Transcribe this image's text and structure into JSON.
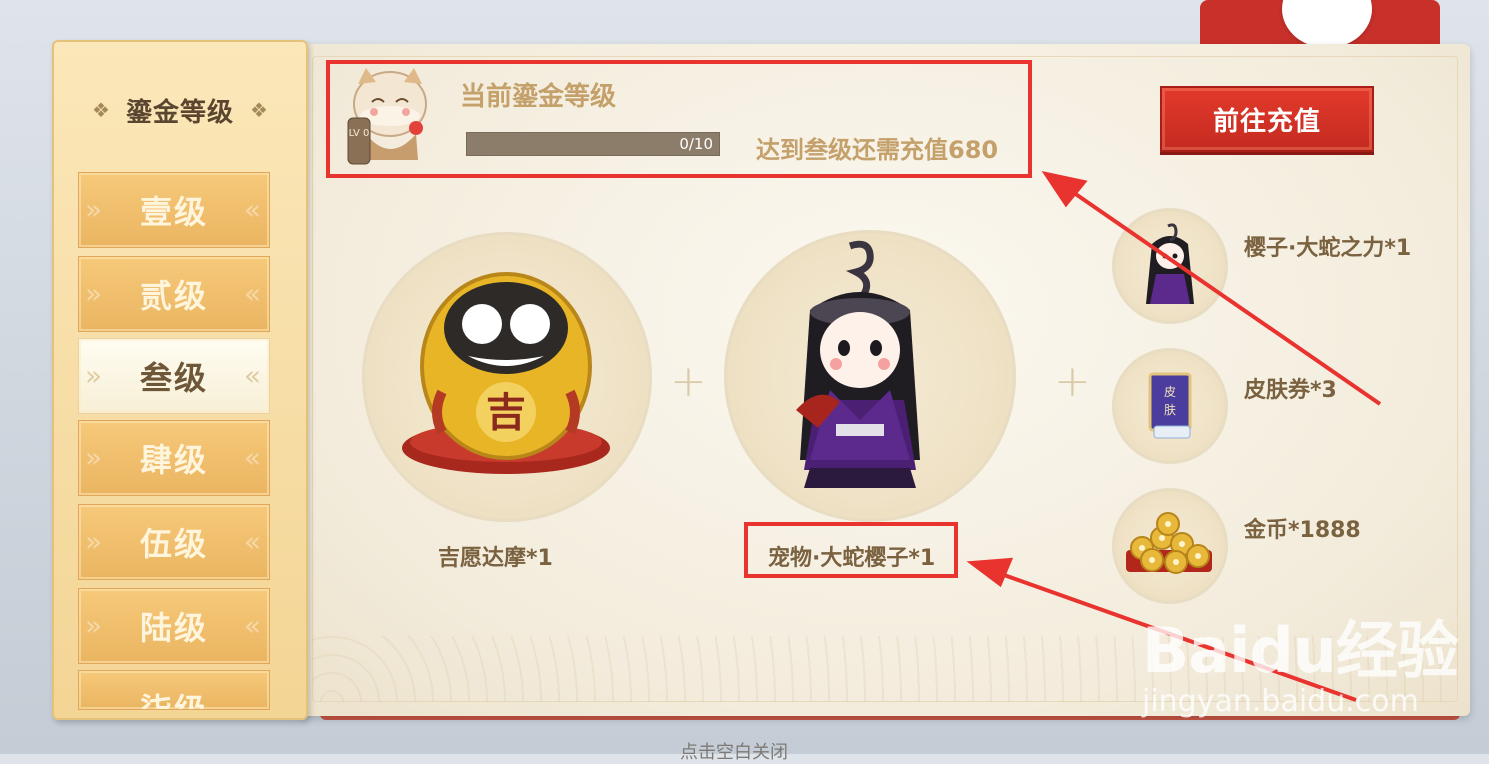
{
  "sidebar": {
    "title": "鎏金等级",
    "levels": [
      {
        "label": "壹级",
        "active": false
      },
      {
        "label": "贰级",
        "active": false
      },
      {
        "label": "叁级",
        "active": true
      },
      {
        "label": "肆级",
        "active": false
      },
      {
        "label": "伍级",
        "active": false
      },
      {
        "label": "陆级",
        "active": false
      },
      {
        "label": "柒级",
        "active": false
      }
    ]
  },
  "header": {
    "title": "当前鎏金等级",
    "avatar_level": "LV 0",
    "progress": {
      "text": "0/10",
      "current": 0,
      "max": 10
    },
    "hint": "达到叁级还需充值680",
    "recharge_button": "前往充值"
  },
  "rewards": {
    "main": [
      {
        "label": "吉愿达摩*1",
        "icon": "daruma-icon"
      },
      {
        "label": "宠物·大蛇樱子*1",
        "icon": "snake-sakura-pet-icon"
      }
    ],
    "side": [
      {
        "label": "樱子·大蛇之力*1",
        "icon": "sakura-skin-icon"
      },
      {
        "label": "皮肤券*3",
        "icon": "skin-ticket-icon"
      },
      {
        "label": "金币*1888",
        "icon": "gold-coins-icon"
      }
    ],
    "plus": "+"
  },
  "watermark": {
    "brand": "Baidu经验",
    "url": "jingyan.baidu.com"
  },
  "bottom_hint": "点击空白关闭",
  "colors": {
    "accent_red": "#e23a2c",
    "annotation_red": "#e8332f",
    "gold_text": "#c4a06a"
  }
}
